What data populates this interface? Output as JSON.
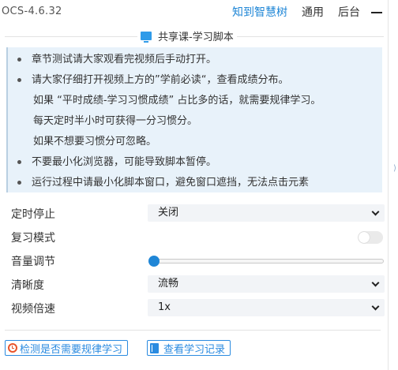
{
  "header": {
    "version": "OCS-4.6.32",
    "nav": [
      {
        "label": "知到智慧树",
        "active": true
      },
      {
        "label": "通用",
        "active": false
      },
      {
        "label": "后台",
        "active": false
      }
    ]
  },
  "section": {
    "title": "共享课-学习脚本",
    "icon": "monitor-icon"
  },
  "notice": {
    "items": [
      "章节测试请大家观看完视频后手动打开。",
      "请大家仔细打开视频上方的”学前必读“，查看成绩分布。",
      "不要最小化浏览器，可能导致脚本暂停。",
      "运行过程中请最小化脚本窗口，避免窗口遮挡，无法点击元素"
    ],
    "sub_lines": [
      "如果 “平时成绩-学习习惯成绩” 占比多的话，就需要规律学习。",
      "每天定时半小时可获得一分习惯分。",
      "如果不想要习惯分可忽略。"
    ]
  },
  "settings": {
    "timer_stop": {
      "label": "定时停止",
      "value": "关闭"
    },
    "review_mode": {
      "label": "复习模式",
      "enabled": false
    },
    "volume": {
      "label": "音量调节",
      "value": 0
    },
    "quality": {
      "label": "清晰度",
      "value": "流畅"
    },
    "speed": {
      "label": "视频倍速",
      "value": "1x"
    }
  },
  "actions": {
    "check_label": "检测是否需要规律学习",
    "records_label": "查看学习记录"
  },
  "colors": {
    "accent": "#1f86d6",
    "notice_bg": "#e8f2fa",
    "clock_icon": "#e8542b"
  }
}
